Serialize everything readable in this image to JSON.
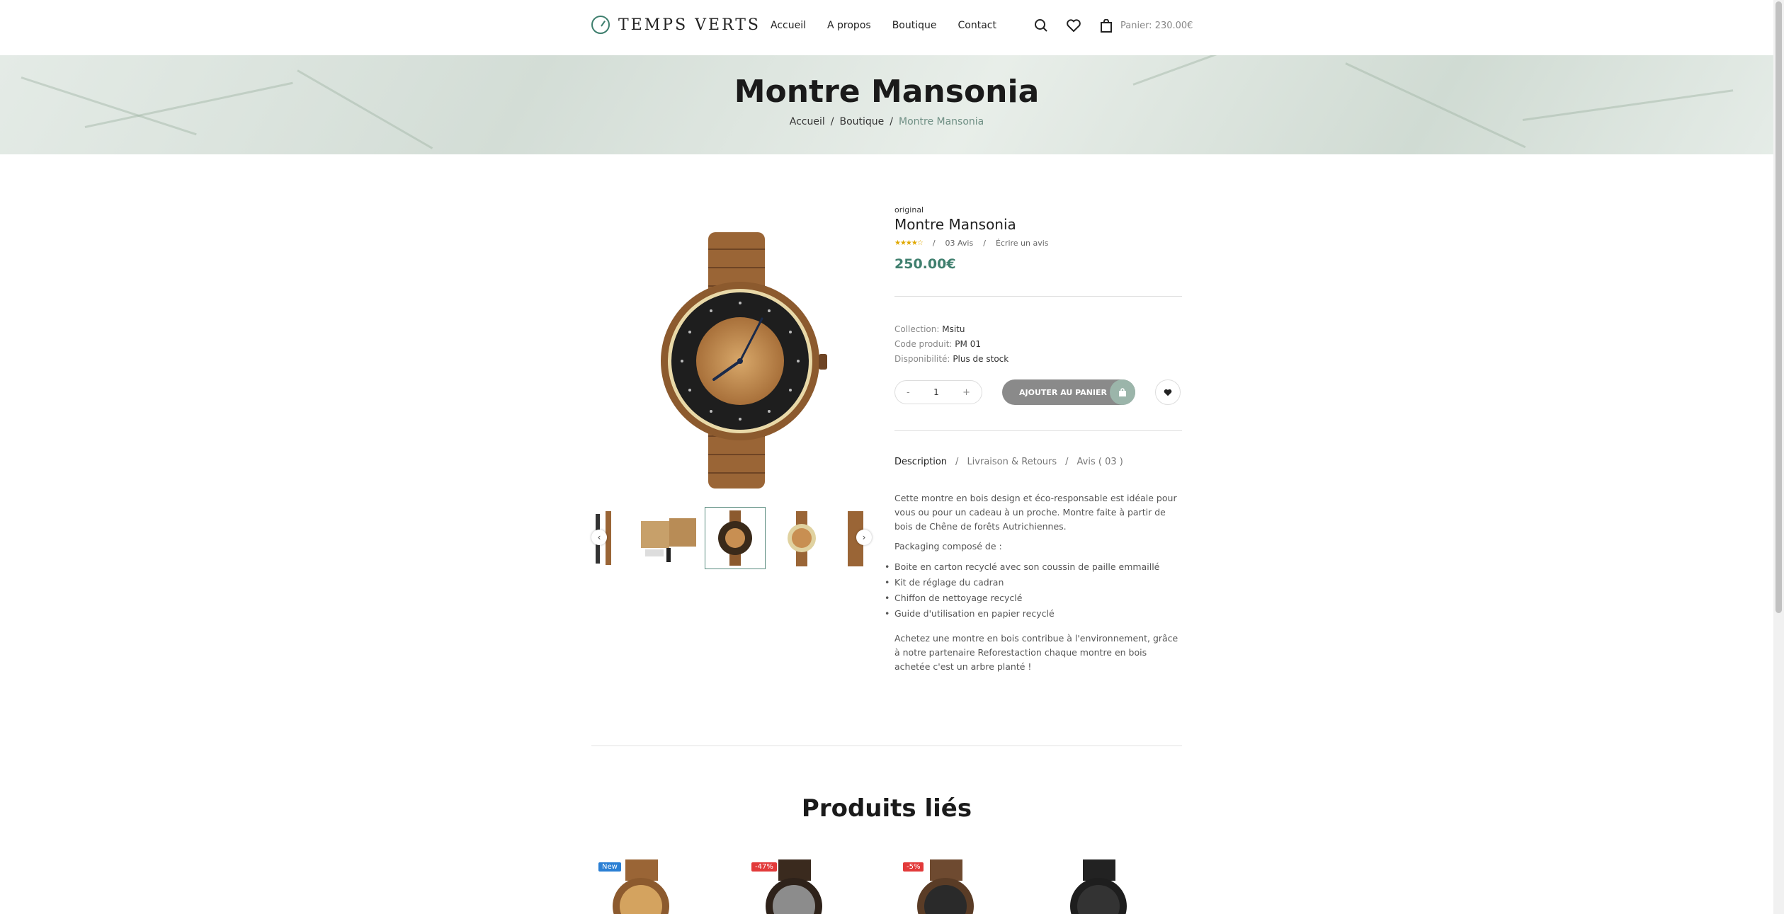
{
  "header": {
    "logo_text": "TEMPS VERTS",
    "nav": [
      "Accueil",
      "A propos",
      "Boutique",
      "Contact"
    ],
    "cart_label": "Panier: 230.00€"
  },
  "hero": {
    "title": "Montre Mansonia",
    "breadcrumb": [
      "Accueil",
      "Boutique",
      "Montre Mansonia"
    ]
  },
  "product": {
    "brand": "original",
    "title": "Montre Mansonia",
    "rating": 4,
    "reviews_label": "03 Avis",
    "write_review": "Écrire un avis",
    "price": "250.00€",
    "collection_label": "Collection:",
    "collection_value": "Msitu",
    "code_label": "Code produit:",
    "code_value": "PM 01",
    "availability_label": "Disponibilité:",
    "availability_value": "Plus de stock",
    "quantity": "1",
    "add_to_cart": "AJOUTER AU PANIER",
    "tabs": [
      "Description",
      "Livraison & Retours",
      "Avis ( 03 )"
    ],
    "description": {
      "intro": "Cette montre en bois design et éco-responsable est idéale pour vous ou pour un cadeau à un proche. Montre faite à partir de bois de Chêne de forêts Autrichiennes.",
      "packaging_title": "Packaging composé de :",
      "items": [
        "Boite en carton recyclé avec son coussin de paille emmaillé",
        "Kit de réglage du cadran",
        "Chiffon de nettoyage recyclé",
        "Guide d'utilisation en papier recyclé"
      ],
      "outro": "Achetez une montre en bois contribue à l'environnement, grâce à notre partenaire Reforestaction chaque montre en bois achetée c'est un arbre planté !"
    }
  },
  "related": {
    "title": "Produits liés",
    "badges": [
      "New",
      "-47%",
      "-5%"
    ]
  },
  "colors": {
    "accent": "#3f7f6e",
    "price": "#3f7f6e",
    "badge_new": "#2a7fd4",
    "badge_sale": "#e23a3a"
  }
}
